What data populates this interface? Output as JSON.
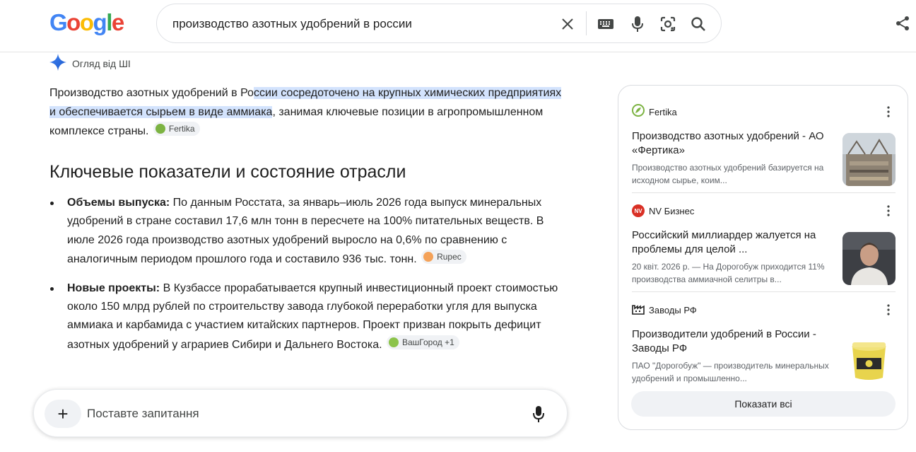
{
  "header": {
    "logo": [
      "G",
      "o",
      "o",
      "g",
      "l",
      "e"
    ],
    "logo_colors": [
      "#4285F4",
      "#EA4335",
      "#FBBC05",
      "#4285F4",
      "#34A853",
      "#EA4335"
    ],
    "search_query": "производство азотных удобрений в россии"
  },
  "ai_overview": {
    "label": "Огляд від ШІ",
    "intro": {
      "pre": "Производство азотных удобрений в Ро",
      "highlight": "ссии сосредоточено на крупных химических предприятиях и обеспечивается сырьем в виде аммиака",
      "post": ", занимая ключевые позиции в агропромышленном комплексе страны.",
      "chip": "Fertika"
    },
    "section_title": "Ключевые показатели и состояние отрасли",
    "bullets": [
      {
        "bold": "Объемы выпуска:",
        "text": " По данным Росстата, за январь–июль 2026 года выпуск минеральных удобрений в стране составил 17,6 млн тонн в пересчете на 100% питательных веществ. В июле 2026 года производство азотных удобрений выросло на 0,6% по сравнению с аналогичным периодом прошлого года и составило 936 тыс. тонн.",
        "chip": "Rupec"
      },
      {
        "bold": "Новые проекты:",
        "text": " В Кузбассе прорабатывается крупный инвестиционный проект стоимостью около 150 млрд рублей по строительству завода глубокой переработки угля для выпуска аммиака и карбамида с участием китайских партнеров. Проект призван покрыть дефицит азотных удобрений у аграриев Сибири и Дальнего Востока.",
        "chip": "ВашГород",
        "chip_extra": "+1"
      }
    ]
  },
  "ask": {
    "plus": "+",
    "placeholder": "Поставте запитання"
  },
  "sources": {
    "items": [
      {
        "site": "Fertika",
        "title": "Производство азотных удобрений - АО «Фертика»",
        "desc": "Производство азотных удобрений базируется на исходном сырье, коим..."
      },
      {
        "site": "NV Бизнес",
        "logo_text": "NV",
        "title": "Российский миллиардер жалуется на проблемы для целой ...",
        "desc": "20 квіт. 2026 р. — На Дорогобуж приходится 11% производства аммиачной селитры в..."
      },
      {
        "site": "Заводы РФ",
        "title": "Производители удобрений в России - Заводы РФ",
        "desc": "ПАО \"Дорогобуж\" — производитель минеральных удобрений и промышленно..."
      }
    ],
    "show_all": "Показати всі"
  },
  "colors": {
    "highlight": "#d3e3fd",
    "fertika": "#7cb342",
    "rupec": "#f4a259",
    "nv": "#d93025",
    "vashgorod": "#8bc34a"
  }
}
